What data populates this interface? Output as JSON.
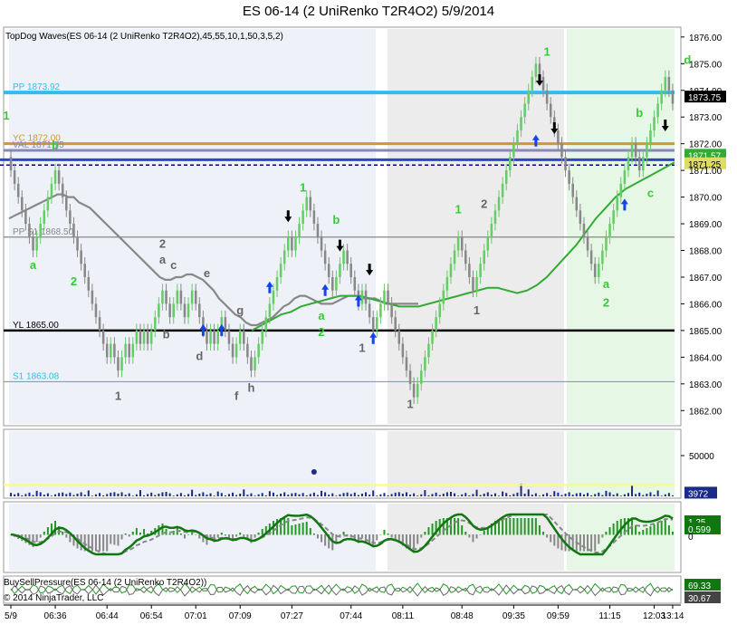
{
  "title": "ES 06-14 (2 UniRenko T2R4O2)  5/9/2014",
  "indicator_label": "TopDog Waves(ES 06-14 (2 UniRenko T2R4O2),45,55,10,1,50,3,5,2)",
  "bsp_label": "BuySellPressure(ES 06-14 (2 UniRenko T2R4O2))",
  "copyright": "© 2014 NinjaTrader, LLC",
  "chart_data": {
    "type": "candlestick",
    "ylim": [
      1861.5,
      1876.3
    ],
    "y_ticks": [
      "1862.00",
      "1863.00",
      "1864.00",
      "1865.00",
      "1866.00",
      "1867.00",
      "1868.00",
      "1869.00",
      "1870.00",
      "1871.00",
      "1872.00",
      "1873.00",
      "1874.00",
      "1875.00",
      "1876.00"
    ],
    "x_ticks": [
      "5/9",
      "06:36",
      "06:44",
      "06:54",
      "07:01",
      "07:09",
      "07:27",
      "07:44",
      "08:11",
      "08:48",
      "09:35",
      "09:59",
      "11:15",
      "12:03",
      "13:14"
    ],
    "close_series": [
      1871.0,
      1870.5,
      1870.0,
      1869.5,
      1869.0,
      1868.5,
      1868.0,
      1868.5,
      1869.0,
      1869.5,
      1870.0,
      1870.5,
      1871.0,
      1870.5,
      1870.0,
      1869.5,
      1869.0,
      1868.5,
      1868.0,
      1867.5,
      1867.0,
      1866.5,
      1866.0,
      1865.5,
      1865.0,
      1864.5,
      1864.0,
      1864.5,
      1864.0,
      1863.5,
      1864.0,
      1864.5,
      1864.0,
      1864.5,
      1865.0,
      1864.5,
      1865.0,
      1864.5,
      1865.0,
      1865.5,
      1866.0,
      1866.5,
      1866.0,
      1865.5,
      1866.0,
      1866.5,
      1866.0,
      1865.5,
      1866.0,
      1866.5,
      1866.0,
      1865.5,
      1865.0,
      1864.5,
      1865.0,
      1864.5,
      1865.0,
      1865.5,
      1865.0,
      1864.5,
      1864.0,
      1864.5,
      1865.0,
      1864.5,
      1864.0,
      1863.5,
      1864.0,
      1864.5,
      1865.0,
      1865.5,
      1866.0,
      1866.5,
      1867.0,
      1867.5,
      1868.0,
      1868.5,
      1868.0,
      1868.5,
      1869.0,
      1869.5,
      1870.0,
      1869.5,
      1869.0,
      1868.5,
      1868.0,
      1867.5,
      1867.0,
      1866.5,
      1867.0,
      1867.5,
      1868.0,
      1867.5,
      1867.0,
      1866.5,
      1866.0,
      1866.5,
      1866.0,
      1865.5,
      1865.0,
      1865.5,
      1866.0,
      1866.5,
      1866.0,
      1865.5,
      1865.0,
      1864.5,
      1864.0,
      1863.5,
      1863.0,
      1862.5,
      1863.0,
      1863.5,
      1864.0,
      1864.5,
      1865.0,
      1865.5,
      1866.0,
      1866.5,
      1867.0,
      1867.5,
      1868.0,
      1868.5,
      1868.0,
      1867.5,
      1867.0,
      1866.5,
      1867.0,
      1867.5,
      1868.0,
      1868.5,
      1869.0,
      1869.5,
      1870.0,
      1870.5,
      1871.0,
      1871.5,
      1872.0,
      1872.5,
      1873.0,
      1873.5,
      1874.0,
      1874.5,
      1875.0,
      1874.5,
      1874.0,
      1873.5,
      1873.0,
      1872.5,
      1872.0,
      1871.5,
      1871.0,
      1870.5,
      1870.0,
      1869.5,
      1869.0,
      1868.5,
      1868.0,
      1867.5,
      1867.0,
      1867.5,
      1868.0,
      1868.5,
      1869.0,
      1869.5,
      1870.0,
      1870.5,
      1871.0,
      1871.5,
      1872.0,
      1871.5,
      1871.0,
      1871.5,
      1872.0,
      1872.5,
      1873.0,
      1873.5,
      1874.0,
      1874.5,
      1874.0,
      1873.5
    ],
    "sma_series": [
      1869.2,
      1869.3,
      1869.4,
      1869.5,
      1869.6,
      1869.7,
      1869.8,
      1869.9,
      1870.0,
      1870.1,
      1870.1,
      1870.0,
      1870.0,
      1869.8,
      1869.7,
      1869.6,
      1869.4,
      1869.2,
      1869.0,
      1868.8,
      1868.6,
      1868.4,
      1868.2,
      1868.0,
      1867.8,
      1867.6,
      1867.4,
      1867.2,
      1867.0,
      1866.9,
      1866.9,
      1867.0,
      1867.0,
      1867.1,
      1867.1,
      1867.0,
      1866.9,
      1866.7,
      1866.5,
      1866.2,
      1866.0,
      1865.8,
      1865.6,
      1865.5,
      1865.3,
      1865.2,
      1865.2,
      1865.3,
      1865.4,
      1865.5,
      1865.7,
      1865.9,
      1866.0,
      1866.2,
      1866.3,
      1866.3,
      1866.2,
      1866.1,
      1866.0,
      1866.0,
      1866.0,
      1866.1,
      1866.2,
      1866.3,
      1866.3,
      1866.3,
      1866.2,
      1866.2,
      1866.2,
      1866.1,
      1866.0,
      1866.0,
      1866.0,
      1866.0,
      1866.0,
      1866.0,
      1866.0
    ],
    "ema_series": [
      1865.0,
      1865.2,
      1865.4,
      1865.6,
      1865.7,
      1865.9,
      1866.0,
      1866.1,
      1866.2,
      1866.3,
      1866.3,
      1866.3,
      1866.2,
      1866.1,
      1866.0,
      1865.9,
      1865.9,
      1865.9,
      1866.0,
      1866.1,
      1866.2,
      1866.3,
      1866.4,
      1866.5,
      1866.6,
      1866.6,
      1866.5,
      1866.4,
      1866.5,
      1866.7,
      1867.0,
      1867.4,
      1867.8,
      1868.2,
      1868.7,
      1869.2,
      1869.6,
      1870.0,
      1870.3,
      1870.5,
      1870.7,
      1870.9,
      1871.1,
      1871.3
    ],
    "levels": [
      {
        "name": "PP 1873.92",
        "value": 1873.92,
        "color": "#33bbee"
      },
      {
        "name": "YC 1872.00",
        "value": 1872.0,
        "color": "#cc9933"
      },
      {
        "name": "VAL 1871.75",
        "value": 1871.75,
        "color": "#8888bb"
      },
      {
        "name": "PP S1 1868.50",
        "value": 1868.5,
        "color": "#888888"
      },
      {
        "name": "YL 1865.00",
        "value": 1865.0,
        "color": "#000000"
      },
      {
        "name": "S1 1863.08",
        "value": 1863.08,
        "color": "#33bbee"
      }
    ],
    "price_tags": [
      {
        "label": "1873.75",
        "value": 1873.75,
        "bg": "#000000",
        "fg": "#ffffff"
      },
      {
        "label": "1871.57",
        "value": 1871.57,
        "bg": "#33aa33",
        "fg": "#ffffff"
      },
      {
        "label": "1871.25",
        "value": 1871.25,
        "bg": "#dddd66",
        "fg": "#000000"
      }
    ],
    "wave_labels": [
      {
        "t": "1",
        "c": "g",
        "i": -1,
        "v": 1872.9
      },
      {
        "t": "b",
        "c": "g",
        "i": 12,
        "v": 1871.8
      },
      {
        "t": "a",
        "c": "g",
        "i": 6,
        "v": 1867.3
      },
      {
        "t": "2",
        "c": "g",
        "i": 17,
        "v": 1866.7
      },
      {
        "t": "1",
        "c": "k",
        "i": 29,
        "v": 1862.4
      },
      {
        "t": "2",
        "c": "k",
        "i": 41,
        "v": 1868.1
      },
      {
        "t": "a",
        "c": "k",
        "i": 41,
        "v": 1867.5
      },
      {
        "t": "c",
        "c": "k",
        "i": 44,
        "v": 1867.3
      },
      {
        "t": "b",
        "c": "k",
        "i": 42,
        "v": 1864.7
      },
      {
        "t": "e",
        "c": "k",
        "i": 53,
        "v": 1867.0
      },
      {
        "t": "d",
        "c": "k",
        "i": 51,
        "v": 1863.9
      },
      {
        "t": "g",
        "c": "k",
        "i": 62,
        "v": 1865.6
      },
      {
        "t": "f",
        "c": "k",
        "i": 61,
        "v": 1862.4
      },
      {
        "t": "h",
        "c": "k",
        "i": 65,
        "v": 1862.7
      },
      {
        "t": "1",
        "c": "g",
        "i": 79,
        "v": 1870.2
      },
      {
        "t": "b",
        "c": "g",
        "i": 88,
        "v": 1869.0
      },
      {
        "t": "a",
        "c": "g",
        "i": 84,
        "v": 1865.4
      },
      {
        "t": "2",
        "c": "g",
        "i": 84,
        "v": 1864.8
      },
      {
        "t": "1",
        "c": "k",
        "i": 95,
        "v": 1864.2
      },
      {
        "t": "1",
        "c": "k",
        "i": 108,
        "v": 1862.1
      },
      {
        "t": "1",
        "c": "g",
        "i": 121,
        "v": 1869.4
      },
      {
        "t": "2",
        "c": "k",
        "i": 128,
        "v": 1869.6
      },
      {
        "t": "1",
        "c": "k",
        "i": 126,
        "v": 1865.6
      },
      {
        "t": "1",
        "c": "g",
        "i": 145,
        "v": 1875.3
      },
      {
        "t": "a",
        "c": "g",
        "i": 161,
        "v": 1866.6
      },
      {
        "t": "2",
        "c": "g",
        "i": 161,
        "v": 1865.9
      },
      {
        "t": "b",
        "c": "g",
        "i": 170,
        "v": 1873.0
      },
      {
        "t": "c",
        "c": "g",
        "i": 173,
        "v": 1870.0
      },
      {
        "t": "d",
        "c": "g",
        "i": 183,
        "v": 1875.0
      }
    ],
    "volume_tags": [
      {
        "label": "50000",
        "value": 50000
      },
      {
        "label": "3972",
        "value": 3972
      }
    ],
    "oscillator_tags": [
      "1.25",
      "0.599",
      "0"
    ],
    "bsp_tags": [
      "69.33",
      "30.67"
    ]
  },
  "colors": {
    "bull": "#66cc66",
    "bear": "#888888",
    "neutral": "#000000",
    "shade_blue": "#eef1f8",
    "shade_gray": "#ececec",
    "shade_green": "#e6f7e6",
    "sma": "#888888",
    "ema": "#33aa33",
    "volume": "#1a2a88",
    "volume_ref": "#ffff66"
  }
}
